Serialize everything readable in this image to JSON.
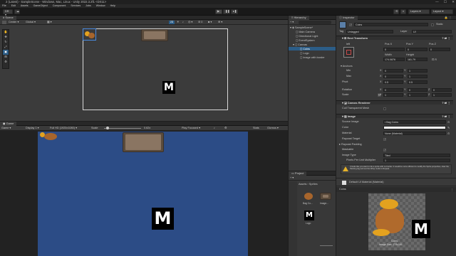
{
  "window": {
    "title": "2 (Latest) - SampleScene - Windows, Mac, Linux - Unity 2022.3.2f1 <DX11>",
    "minimize": "—",
    "maximize": "☐",
    "close": "✕"
  },
  "menu": [
    "File",
    "Edit",
    "Assets",
    "GameObject",
    "Component",
    "Services",
    "Jobs",
    "Window",
    "Help"
  ],
  "toolbar": {
    "account": "DR",
    "layers": "Layers",
    "layout": "Layout"
  },
  "scene": {
    "tab": "Scene",
    "pivot": "Center",
    "space": "Global",
    "mode_2d": "2D"
  },
  "game": {
    "tab": "Game",
    "display_tab": "Game",
    "display": "Display 1",
    "resolution": "Full HD (1920x1080)",
    "scale_label": "Scale",
    "scale_value": "0.62x",
    "play_focused": "Play Focused",
    "stats": "Stats",
    "gizmos": "Gizmos"
  },
  "hierarchy": {
    "tab": "Hierarchy",
    "items": [
      {
        "label": "SampleScene*",
        "indent": 0
      },
      {
        "label": "Main Camera",
        "indent": 1
      },
      {
        "label": "Directional Light",
        "indent": 1
      },
      {
        "label": "EventSystem",
        "indent": 1
      },
      {
        "label": "Canvas",
        "indent": 1
      },
      {
        "label": "Coins",
        "indent": 2,
        "selected": true
      },
      {
        "label": "Logo",
        "indent": 2
      },
      {
        "label": "Image with border",
        "indent": 2
      }
    ]
  },
  "project": {
    "tab": "Project",
    "breadcrumb_assets": "Assets",
    "breadcrumb_sprites": "Sprites",
    "assets": [
      {
        "label": "Bag Co..."
      },
      {
        "label": "Image..."
      },
      {
        "label": "Logo"
      }
    ]
  },
  "inspector": {
    "tab": "Inspector",
    "object_name": "Coins",
    "static_label": "Static",
    "tag_label": "Tag",
    "tag_value": "Untagged",
    "layer_label": "Layer",
    "layer_value": "UI",
    "rect_transform": {
      "header": "Rect Transform",
      "anchor_label": "left",
      "pos_x_label": "Pos X",
      "pos_y_label": "Pos Y",
      "pos_z_label": "Pos Z",
      "pos_x": "0",
      "pos_y": "0",
      "pos_z": "0",
      "width_label": "Width",
      "height_label": "Height",
      "width": "174.0876",
      "height": "161.79",
      "anchors_label": "Anchors",
      "min_label": "Min",
      "max_label": "Max",
      "pivot_label": "Pivot",
      "min_x": "0",
      "min_y": "1",
      "max_x": "0",
      "max_y": "1",
      "pivot_x": "0.5",
      "pivot_y": "0.5",
      "rotation_label": "Rotation",
      "rot_x": "0",
      "rot_y": "0",
      "rot_z": "0",
      "scale_label": "Scale",
      "scale_x": "1",
      "scale_y": "1",
      "scale_z": "1",
      "x": "X",
      "y": "Y",
      "z": "Z"
    },
    "canvas_renderer": {
      "header": "Canvas Renderer",
      "cull_label": "Cull Transparent Mesh"
    },
    "image": {
      "header": "Image",
      "source_label": "Source Image",
      "source_value": "Bag Coins",
      "color_label": "Color",
      "material_label": "Material",
      "material_value": "None (Material)",
      "raycast_target_label": "Raycast Target",
      "raycast_padding_label": "Raycast Padding",
      "maskable_label": "Maskable",
      "image_type_label": "Image Type",
      "image_type_value": "Tiled",
      "ppu_label": "Pixels Per Unit Multiplier",
      "ppu_value": "1",
      "warning": "It looks like you want to tile a sprite with no border. It would be more efficient to modify the Sprite properties, clear the Packing tag and set the Wrap mode to Repeat."
    },
    "material_header": "Default UI Material (Material)",
    "preview_title": "Coins",
    "preview_caption_1": "Coins",
    "preview_caption_2": "Image Size: 174x161"
  },
  "colors": {
    "accent": "#2c5d87",
    "game_bg": "#2c4c86",
    "warning": "#e5b22a"
  }
}
